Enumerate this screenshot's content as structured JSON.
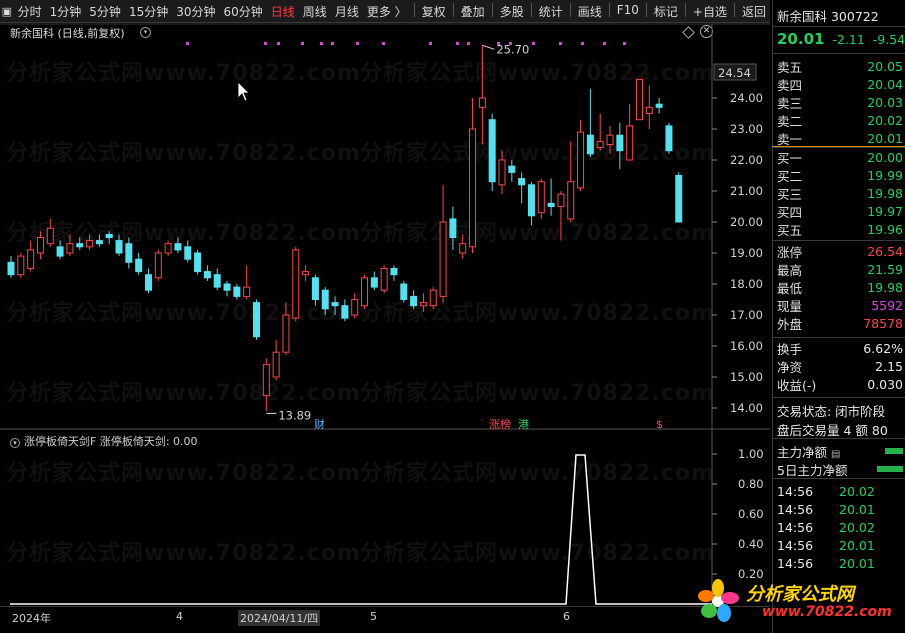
{
  "toolbar": {
    "items": [
      {
        "label": "分时",
        "active": false
      },
      {
        "label": "1分钟",
        "active": false
      },
      {
        "label": "5分钟",
        "active": false
      },
      {
        "label": "15分钟",
        "active": false
      },
      {
        "label": "30分钟",
        "active": false
      },
      {
        "label": "60分钟",
        "active": false
      },
      {
        "label": "日线",
        "active": true
      },
      {
        "label": "周线",
        "active": false
      },
      {
        "label": "月线",
        "active": false
      },
      {
        "label": "更多 〉",
        "active": false
      }
    ],
    "right_items": [
      "复权",
      "叠加",
      "多股",
      "统计",
      "画线",
      "F10",
      "标记",
      "+自选",
      "返回"
    ]
  },
  "chart": {
    "title": "新余国科 (日线,前复权)",
    "high_marker": "25.70",
    "low_marker": "13.89",
    "price_tag": "24.54",
    "y_ticks": [
      "24.00",
      "23.00",
      "22.00",
      "21.00",
      "20.00",
      "19.00",
      "18.00",
      "17.00",
      "16.00",
      "15.00",
      "14.00"
    ],
    "event_tags": [
      {
        "label": "财",
        "color": "#4fb6ff"
      },
      {
        "label": "涨榜",
        "color": "#ff4646"
      },
      {
        "label": "港",
        "color": "#1fd15c"
      },
      {
        "label": "$",
        "color": "#ff4646"
      }
    ],
    "watermark": "分析家公式网www.70822.com",
    "colors": {
      "up": "#ff4646",
      "down": "#54e1ef",
      "dots": "#d04ad0"
    }
  },
  "indicator": {
    "title": "涨停板倚天剑F  涨停板倚天剑: 0.00",
    "y_ticks": [
      "1.00",
      "0.80",
      "0.60",
      "0.40",
      "0.20"
    ]
  },
  "x_axis": {
    "labels": [
      "2024年",
      "4",
      "2024/04/11/四",
      "5",
      "6"
    ]
  },
  "quote": {
    "name": "新余国科 300722",
    "price": "20.01",
    "change": "-2.11",
    "change_pct": "-9.54",
    "asks": [
      {
        "label": "卖五",
        "price": "20.05"
      },
      {
        "label": "卖四",
        "price": "20.04"
      },
      {
        "label": "卖三",
        "price": "20.03"
      },
      {
        "label": "卖二",
        "price": "20.02"
      },
      {
        "label": "卖一",
        "price": "20.01"
      }
    ],
    "bids": [
      {
        "label": "买一",
        "price": "20.00"
      },
      {
        "label": "买二",
        "price": "19.99"
      },
      {
        "label": "买三",
        "price": "19.98"
      },
      {
        "label": "买四",
        "price": "19.97"
      },
      {
        "label": "买五",
        "price": "19.96"
      }
    ],
    "stats": [
      {
        "label": "涨停",
        "value": "26.54",
        "color": "red"
      },
      {
        "label": "最高",
        "value": "21.59",
        "color": "green"
      },
      {
        "label": "最低",
        "value": "19.98",
        "color": "green"
      },
      {
        "label": "现量",
        "value": "5592",
        "color": "magenta"
      },
      {
        "label": "外盘",
        "value": "78578",
        "color": "red"
      }
    ],
    "stats2": [
      {
        "label": "换手",
        "value": "6.62%"
      },
      {
        "label": "净资",
        "value": "2.15"
      },
      {
        "label": "收益(-)",
        "value": "0.030"
      }
    ],
    "status": "交易状态: 闭市阶段",
    "after_hours": "盘后交易量 4 额 80",
    "flow": [
      {
        "label": "主力净额"
      },
      {
        "label": "5日主力净额"
      }
    ],
    "ticks": [
      {
        "time": "14:56",
        "price": "20.02"
      },
      {
        "time": "14:56",
        "price": "20.01"
      },
      {
        "time": "14:56",
        "price": "20.02"
      },
      {
        "time": "14:56",
        "price": "20.01"
      },
      {
        "time": "14:56",
        "price": "20.01"
      }
    ]
  },
  "logo": {
    "name": "分析家公式网",
    "url": "www.70822.com"
  }
}
